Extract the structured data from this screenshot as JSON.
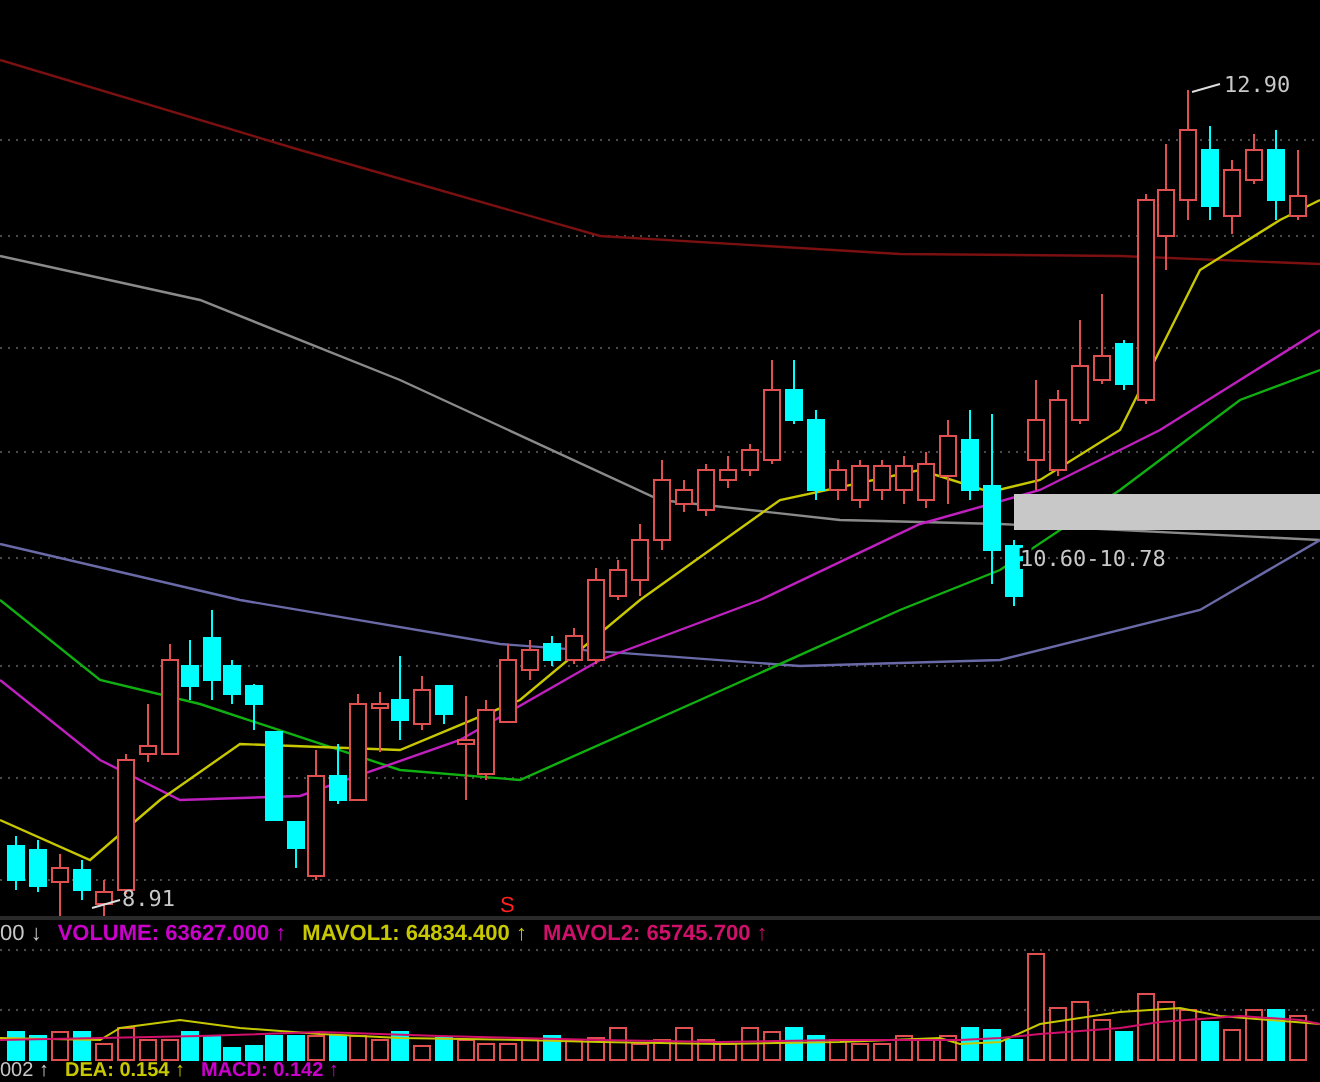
{
  "price_chart": {
    "high_label": "12.90",
    "low_label": "8.91",
    "signal_marker": "S",
    "range_label": "10.60-10.78"
  },
  "volume_legend": {
    "lead": {
      "text": "00",
      "arrow": "↓"
    },
    "items": [
      {
        "text": "VOLUME: 63627.000",
        "arrow": "↑",
        "color": "#cc00cc"
      },
      {
        "text": "MAVOL1: 64834.400",
        "arrow": "↑",
        "color": "#c8c800"
      },
      {
        "text": "MAVOL2: 65745.700",
        "arrow": "↑",
        "color": "#d0106a"
      }
    ]
  },
  "macd_legend": {
    "lead": {
      "text": "002",
      "arrow": "↑"
    },
    "items": [
      {
        "text": "DEA: 0.154",
        "arrow": "↑",
        "color": "#c8c800"
      },
      {
        "text": "MACD: 0.142",
        "arrow": "↑",
        "color": "#cc00cc"
      }
    ]
  }
}
